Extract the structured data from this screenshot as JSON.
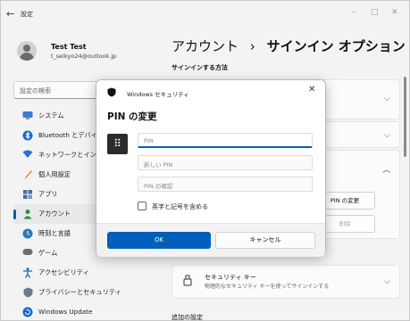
{
  "titlebar": {
    "back_icon": "←",
    "title": "設定",
    "minimize": "–",
    "maximize": "▢",
    "close": "✕"
  },
  "profile": {
    "name": "Test Test",
    "email": "t_seikyo24@outlook.jp"
  },
  "search": {
    "placeholder": "設定の検索"
  },
  "nav": {
    "items": [
      {
        "label": "システム",
        "icon": "system-icon"
      },
      {
        "label": "Bluetooth とデバイス",
        "icon": "bluetooth-icon"
      },
      {
        "label": "ネットワークとインター",
        "icon": "network-icon"
      },
      {
        "label": "個人用設定",
        "icon": "personalization-icon"
      },
      {
        "label": "アプリ",
        "icon": "apps-icon"
      },
      {
        "label": "アカウント",
        "icon": "accounts-icon",
        "active": true
      },
      {
        "label": "時刻と言語",
        "icon": "time-language-icon"
      },
      {
        "label": "ゲーム",
        "icon": "gaming-icon"
      },
      {
        "label": "アクセシビリティ",
        "icon": "accessibility-icon"
      },
      {
        "label": "プライバシーとセキュリティ",
        "icon": "privacy-shield-icon"
      },
      {
        "label": "Windows Update",
        "icon": "windows-update-icon"
      }
    ]
  },
  "main": {
    "breadcrumb_parent": "アカウント",
    "breadcrumb_sep": "›",
    "breadcrumb_current": "サインイン オプション",
    "section_title": "サインインする方法",
    "pin_change_button": "PIN の変更",
    "remove_button": "削除",
    "security_key_title": "セキュリティ キー",
    "security_key_desc": "物理的なセキュリティ キーを使ってサインインする",
    "additional_settings": "追加の設定"
  },
  "dialog": {
    "app_name": "Windows セキュリティ",
    "title": "PIN の変更",
    "pin_placeholder": "PIN",
    "new_pin_placeholder": "新しい PIN",
    "confirm_pin_placeholder": "PIN の確認",
    "checkbox_label": "英字と記号を含める",
    "ok": "OK",
    "cancel": "キャンセル"
  },
  "colors": {
    "accent": "#005fb8",
    "window_bg": "#f3f3f3",
    "card_bg": "#fbfbfb"
  }
}
